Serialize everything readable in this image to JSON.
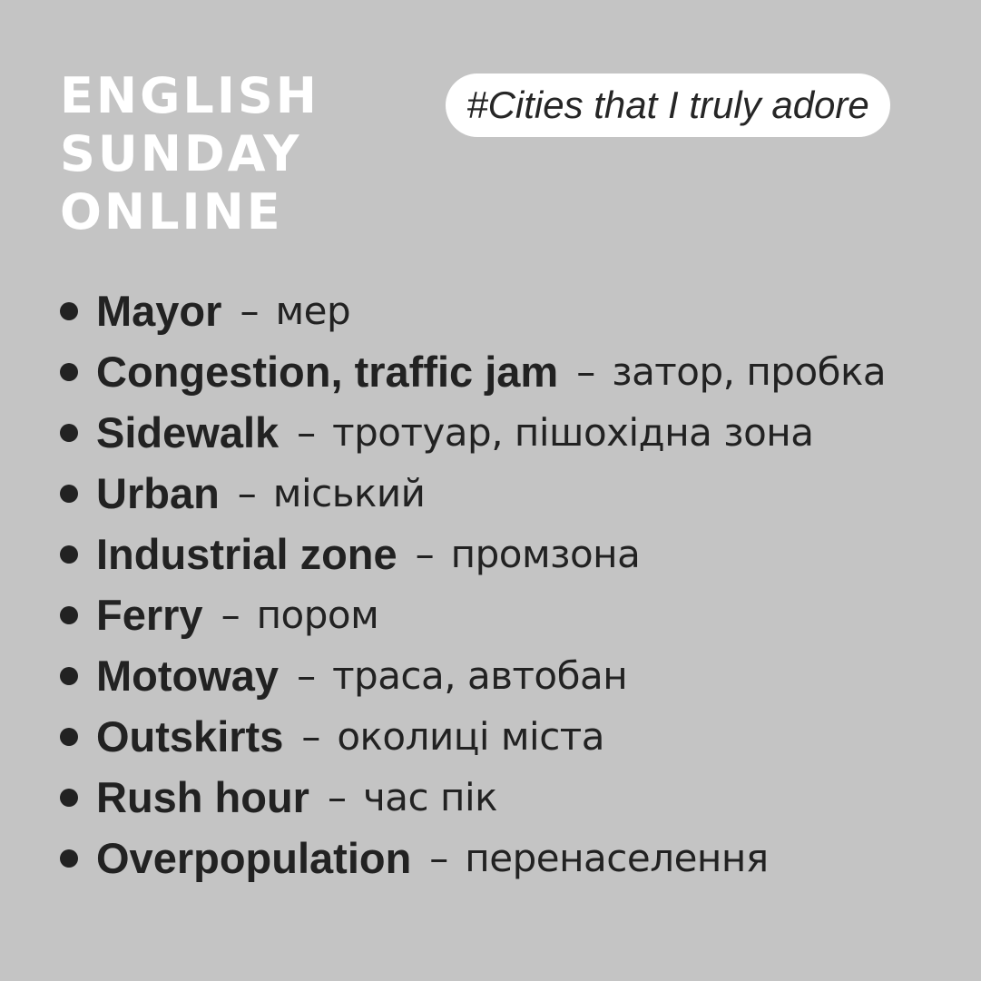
{
  "brand": {
    "lines": [
      "ENGLISH",
      "SUNDAY",
      "ONLINE"
    ]
  },
  "tag": "#Cities that I truly adore",
  "separator": "–",
  "vocabulary": [
    {
      "term": "Mayor",
      "translation": "мер"
    },
    {
      "term": "Congestion, traffic jam",
      "translation": "затор, пробка"
    },
    {
      "term": "Sidewalk",
      "translation": "тротуар, пішохідна зона"
    },
    {
      "term": "Urban",
      "translation": "міський"
    },
    {
      "term": "Industrial zone",
      "translation": "промзона"
    },
    {
      "term": "Ferry",
      "translation": "пором"
    },
    {
      "term": "Motoway",
      "translation": "траса, автобан"
    },
    {
      "term": "Outskirts",
      "translation": "околиці міста"
    },
    {
      "term": "Rush hour",
      "translation": "час пік"
    },
    {
      "term": "Overpopulation",
      "translation": "перенаселення"
    }
  ],
  "colors": {
    "background": "#c4c4c4",
    "brand_text": "#ffffff",
    "pill_background": "#ffffff",
    "text": "#222222"
  }
}
